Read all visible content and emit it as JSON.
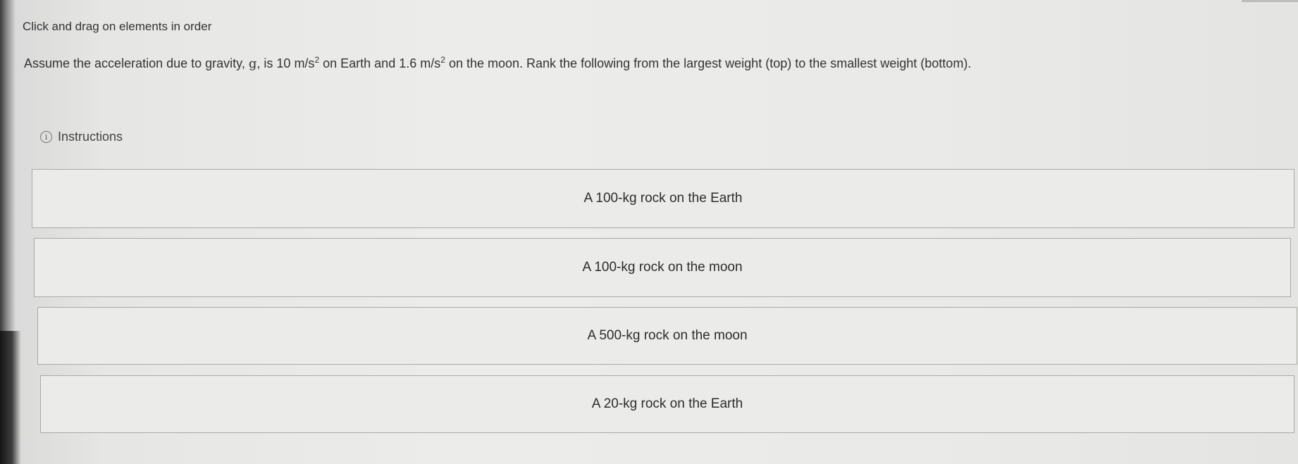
{
  "directive": "Click and drag on elements in order",
  "question": {
    "part1": "Assume the acceleration due to gravity, ",
    "g_symbol": "g",
    "part2": ", is ",
    "earth_value": "10",
    "unit": "m/s",
    "exponent": "2",
    "part3": " on Earth and ",
    "moon_value": "1.6",
    "part4": " on the moon. Rank the following from the largest weight (top) to the smallest weight (bottom)."
  },
  "instructions": {
    "icon": "info-circle-icon",
    "label": "Instructions"
  },
  "rank_items": [
    {
      "label": "A 100-kg rock on the Earth"
    },
    {
      "label": "A 100-kg rock on the moon"
    },
    {
      "label": "A 500-kg rock on the moon"
    },
    {
      "label": "A 20-kg rock on the Earth"
    }
  ]
}
